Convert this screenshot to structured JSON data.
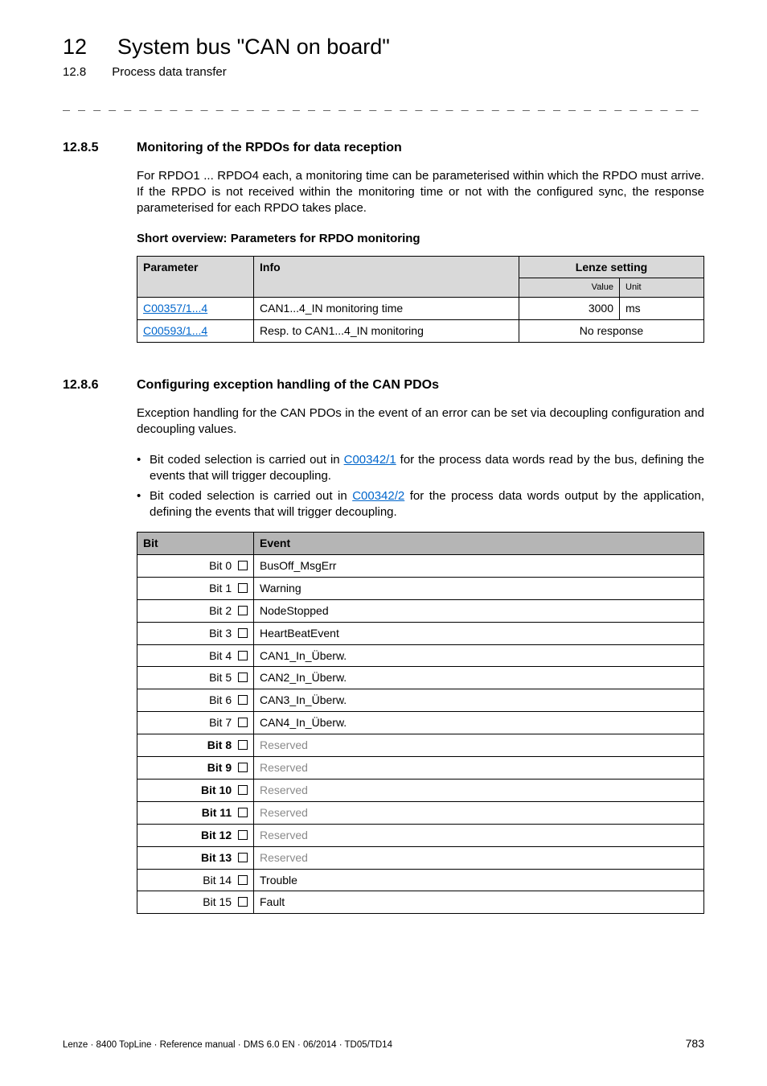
{
  "header": {
    "chapter_num": "12",
    "chapter_title": "System bus \"CAN on board\"",
    "sub_num": "12.8",
    "sub_title": "Process data transfer",
    "dash_line": "_ _ _ _ _ _ _ _ _ _ _ _ _ _ _ _ _ _ _ _ _ _ _ _ _ _ _ _ _ _ _ _ _ _ _ _ _ _ _ _ _ _ _ _ _ _ _ _ _ _ _ _ _ _ _ _ _ _ _ _ _ _ _ _"
  },
  "section1": {
    "num": "12.8.5",
    "title": "Monitoring of the RPDOs for data reception",
    "para": "For RPDO1 ... RPDO4 each, a monitoring time can be parameterised within which the RPDO must arrive. If the RPDO is not received within the monitoring time or not with the configured sync, the response parameterised for each RPDO takes place.",
    "short_overview": "Short overview: Parameters for RPDO monitoring",
    "table": {
      "head_parameter": "Parameter",
      "head_info": "Info",
      "head_setting": "Lenze setting",
      "sub_value": "Value",
      "sub_unit": "Unit",
      "rows": [
        {
          "param": "C00357/1...4",
          "info": "CAN1...4_IN monitoring time",
          "value": "3000",
          "unit": "ms",
          "combined": false
        },
        {
          "param": "C00593/1...4",
          "info": "Resp. to CAN1...4_IN monitoring",
          "value": "",
          "unit": "",
          "combined": true,
          "combined_text": "No response"
        }
      ]
    }
  },
  "section2": {
    "num": "12.8.6",
    "title": "Configuring exception handling of the CAN PDOs",
    "para": "Exception handling for the CAN PDOs in the event of an error can be set via decoupling configuration and decoupling values.",
    "bullets": [
      {
        "pre": "Bit coded selection is carried out in ",
        "link": "C00342/1",
        "post": " for the process data words read by the bus, defining the events that will trigger decoupling."
      },
      {
        "pre": "Bit coded selection is carried out in ",
        "link": "C00342/2",
        "post": " for the process data words output by the application, defining the events that will trigger decoupling."
      }
    ],
    "table": {
      "head_bit": "Bit",
      "head_event": "Event",
      "rows": [
        {
          "bit": "Bit 0",
          "event": "BusOff_MsgErr",
          "reserved": false
        },
        {
          "bit": "Bit 1",
          "event": "Warning",
          "reserved": false
        },
        {
          "bit": "Bit 2",
          "event": "NodeStopped",
          "reserved": false
        },
        {
          "bit": "Bit 3",
          "event": "HeartBeatEvent",
          "reserved": false
        },
        {
          "bit": "Bit 4",
          "event": "CAN1_In_Überw.",
          "reserved": false
        },
        {
          "bit": "Bit 5",
          "event": "CAN2_In_Überw.",
          "reserved": false
        },
        {
          "bit": "Bit 6",
          "event": "CAN3_In_Überw.",
          "reserved": false
        },
        {
          "bit": "Bit 7",
          "event": "CAN4_In_Überw.",
          "reserved": false
        },
        {
          "bit": "Bit 8",
          "event": "Reserved",
          "reserved": true
        },
        {
          "bit": "Bit 9",
          "event": "Reserved",
          "reserved": true
        },
        {
          "bit": "Bit 10",
          "event": "Reserved",
          "reserved": true
        },
        {
          "bit": "Bit 11",
          "event": "Reserved",
          "reserved": true
        },
        {
          "bit": "Bit 12",
          "event": "Reserved",
          "reserved": true
        },
        {
          "bit": "Bit 13",
          "event": "Reserved",
          "reserved": true
        },
        {
          "bit": "Bit 14",
          "event": "Trouble",
          "reserved": false
        },
        {
          "bit": "Bit 15",
          "event": "Fault",
          "reserved": false
        }
      ]
    }
  },
  "footer": {
    "left": "Lenze · 8400 TopLine · Reference manual · DMS 6.0 EN · 06/2014 · TD05/TD14",
    "page": "783"
  }
}
